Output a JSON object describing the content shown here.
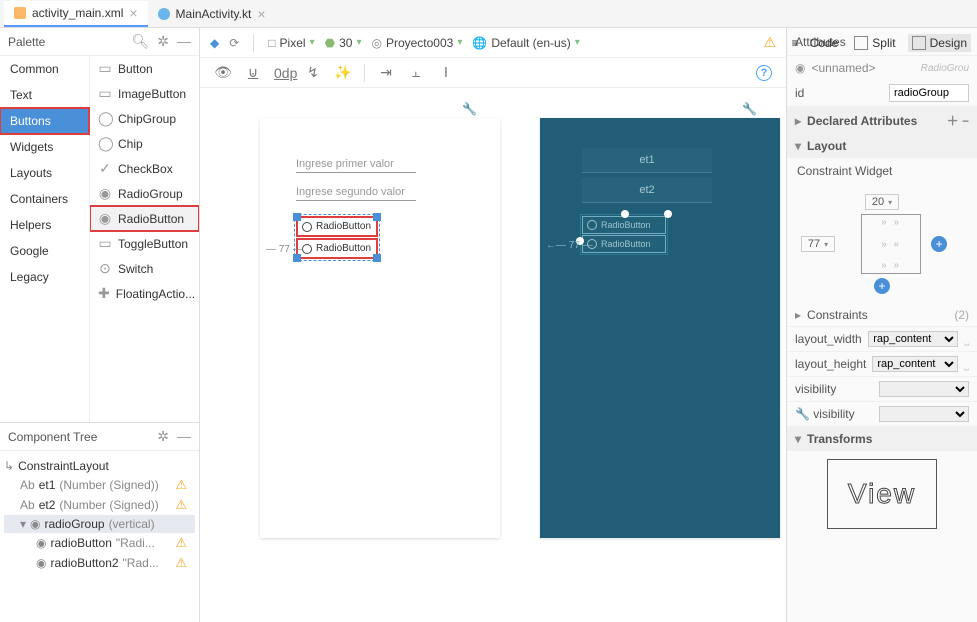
{
  "tabs": {
    "activity": "activity_main.xml",
    "mainactivity": "MainActivity.kt"
  },
  "viewtabs": {
    "code": "Code",
    "split": "Split",
    "design": "Design"
  },
  "palette": {
    "title": "Palette",
    "categories": [
      "Common",
      "Text",
      "Buttons",
      "Widgets",
      "Layouts",
      "Containers",
      "Helpers",
      "Google",
      "Legacy"
    ],
    "selectedCategory": "Buttons",
    "items": [
      "Button",
      "ImageButton",
      "ChipGroup",
      "Chip",
      "CheckBox",
      "RadioGroup",
      "RadioButton",
      "ToggleButton",
      "Switch",
      "FloatingActio..."
    ],
    "selectedItem": "RadioButton"
  },
  "componentTree": {
    "title": "Component Tree",
    "root": "ConstraintLayout",
    "et1": "et1",
    "et1_sig": "(Number (Signed))",
    "et2": "et2",
    "et2_sig": "(Number (Signed))",
    "radioGroup": "radioGroup",
    "radioGroup_orient": "(vertical)",
    "radioButton": "radioButton",
    "radioButton_txt": "\"Radi...",
    "radioButton2": "radioButton2",
    "radioButton2_txt": "\"Rad..."
  },
  "deviceToolbar": {
    "device": "Pixel",
    "api": "30",
    "project": "Proyecto003",
    "locale": "Default (en-us)"
  },
  "designToolbar": {
    "dp": "0dp"
  },
  "canvas": {
    "et1_ph": "Ingrese primer valor",
    "et2_ph": "Ingrese segundo valor",
    "rb1": "RadioButton",
    "rb2": "RadioButton",
    "dim77": "77",
    "blue_et1": "et1",
    "blue_et2": "et2",
    "blue_rb1": "RadioButton",
    "blue_rb2": "RadioButton"
  },
  "attributes": {
    "title": "Attributes",
    "unnamed": "<unnamed>",
    "unnamedType": "RadioGrou",
    "id_label": "id",
    "id_value": "radioGroup",
    "declared": "Declared Attributes",
    "layout": "Layout",
    "constraintWidget": "Constraint Widget",
    "cw_top": "20",
    "cw_left": "77",
    "constraints": "Constraints",
    "constraints_count": "(2)",
    "lw_label": "layout_width",
    "lw_val": "rap_content",
    "lh_label": "layout_height",
    "lh_val": "rap_content",
    "vis_label": "visibility",
    "toolsvis_label": "visibility",
    "transforms": "Transforms",
    "view": "View"
  }
}
